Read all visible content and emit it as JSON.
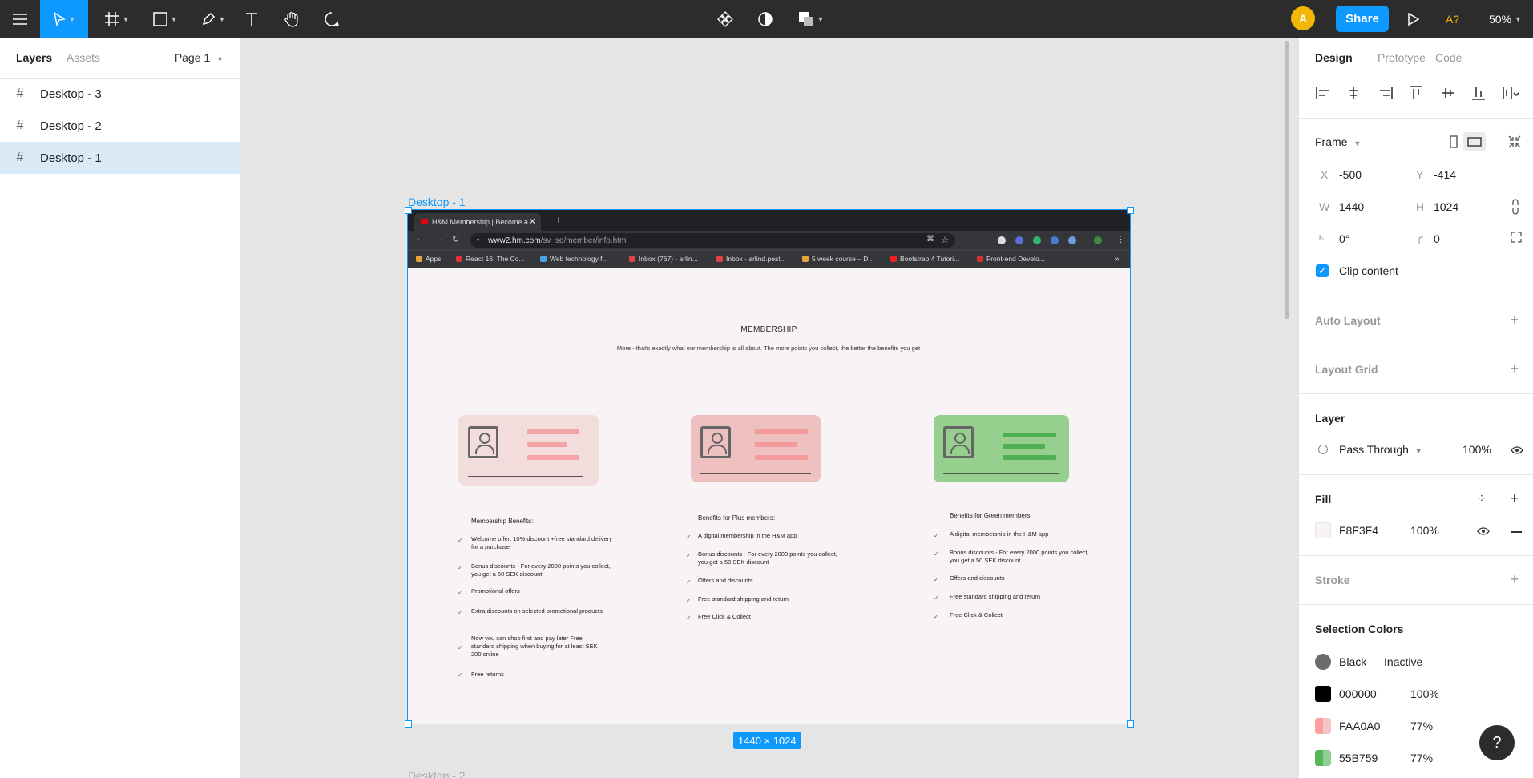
{
  "toolbar": {
    "share_label": "Share",
    "avatar_initial": "A",
    "font_check": "A?",
    "zoom": "50%"
  },
  "left_panel": {
    "tabs": [
      "Layers",
      "Assets"
    ],
    "page": "Page 1",
    "layers": [
      "Desktop - 3",
      "Desktop - 2",
      "Desktop - 1"
    ]
  },
  "canvas": {
    "frame_label": "Desktop - 1",
    "frame_label_below": "Desktop - 2",
    "dimensions": "1440 × 1024"
  },
  "browser": {
    "tab_title": "H&M Membership | Become a ...",
    "url_host": "www2.hm.com",
    "url_path": "/sv_se/member/info.html",
    "bookmarks": [
      "Apps",
      "React 16: The Co...",
      "Web technology f...",
      "Inbox (767) - arlin...",
      "Inbox - arlind.pest...",
      "5 week course – D...",
      "Bootstrap 4 Tutori...",
      "Front-end Develo..."
    ],
    "more": "»"
  },
  "page": {
    "title": "MEMBERSHIP",
    "subtitle": "More - that's exactly what our membership is all about. The more points you collect, the better the benefits you get",
    "columns": [
      {
        "title": "Membership Benefits:",
        "items": [
          " Welcome offer: 10% discount +free standard delivery for a purchase",
          " Bonus discounts - For every 2000 points you collect, you get a 50 SEK discount",
          "Promotional offers",
          "Extra discounts on selected promotional products",
          "Now you can shop first and pay later Free standard shipping when buying for at least SEK 200 online",
          "Free returns"
        ]
      },
      {
        "title": "Benefits for Plus members:",
        "items": [
          "A digital membership in the H&M app",
          "Bonus discounts - For every 2000 points you collect, you get a 50 SEK discount",
          "Offers and discounts",
          "Free standard shipping and return",
          "Free Click & Collect"
        ]
      },
      {
        "title": "Benefits for Green members:",
        "items": [
          "A digital membership in the H&M app",
          "Bonus discounts - For every 2000 points you collect, you get a 50 SEK discount",
          "Offers and discounts",
          "Free standard shipping and return",
          "Free Click & Collect"
        ]
      }
    ],
    "check": "✓"
  },
  "right_panel": {
    "tabs": [
      "Design",
      "Prototype",
      "Code"
    ],
    "frame_label": "Frame",
    "x_label": "X",
    "x": "-500",
    "y_label": "Y",
    "y": "-414",
    "w_label": "W",
    "w": "1440",
    "h_label": "H",
    "h": "1024",
    "rotation": "0°",
    "radius": "0",
    "clip_content": "Clip content",
    "auto_layout": "Auto Layout",
    "layout_grid": "Layout Grid",
    "layer": "Layer",
    "blend": "Pass Through",
    "opacity": "100%",
    "fill": "Fill",
    "fill_hex": "F8F3F4",
    "fill_opacity": "100%",
    "stroke": "Stroke",
    "selection_colors": "Selection Colors",
    "colors": [
      {
        "name": "Black — Inactive",
        "opacity": "",
        "hex_color": "#6b6b6b"
      },
      {
        "name": "000000",
        "opacity": "100%",
        "hex_color": "#000000"
      },
      {
        "name": "FAA0A0",
        "opacity": "77%",
        "hex_color": "#faa0a0"
      },
      {
        "name": "55B759",
        "opacity": "77%",
        "hex_color": "#55b759"
      }
    ]
  },
  "help": "?"
}
